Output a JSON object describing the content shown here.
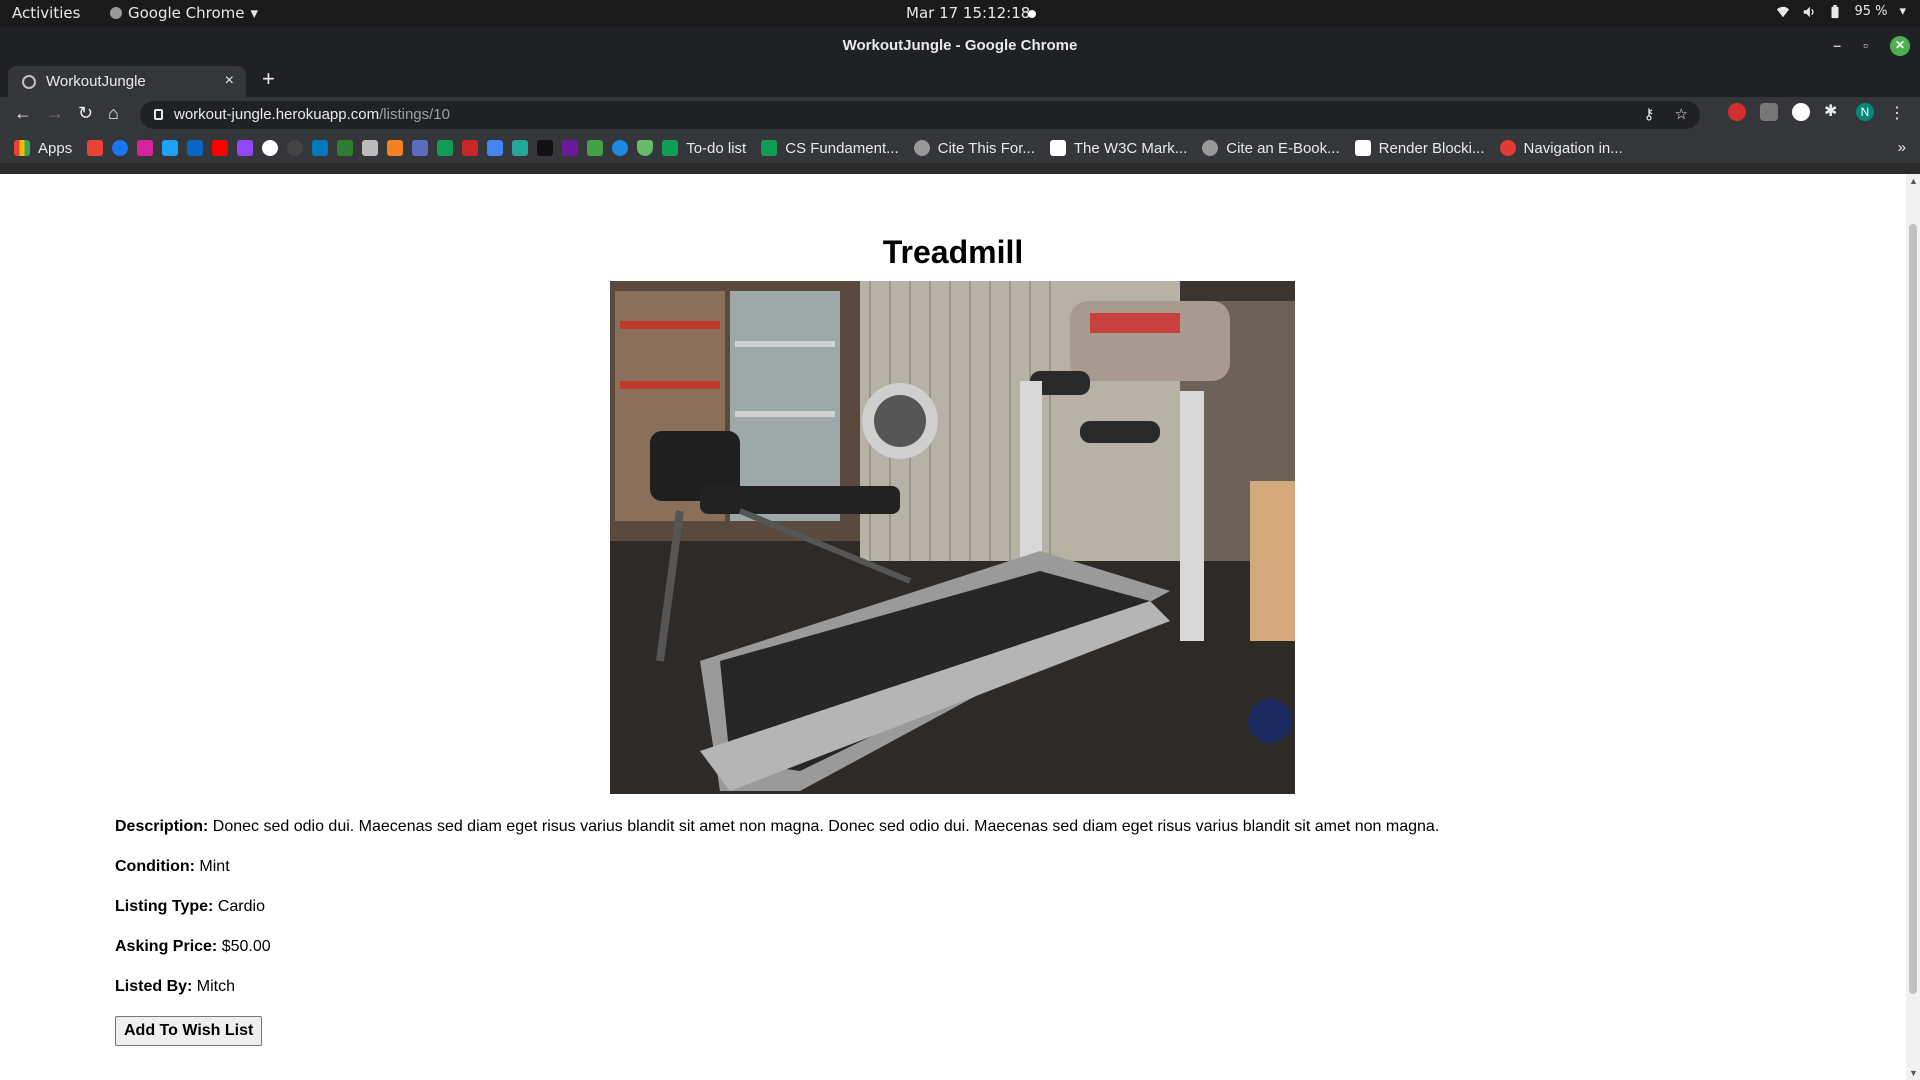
{
  "system_bar": {
    "activities": "Activities",
    "app_name": "Google Chrome",
    "clock": "Mar 17  15:12:18",
    "battery": "95 %"
  },
  "window": {
    "title": "WorkoutJungle - Google Chrome"
  },
  "tab": {
    "label": "WorkoutJungle"
  },
  "address_bar": {
    "host": "workout-jungle.herokuapp.com",
    "path": "/listings/10"
  },
  "bookmarks": {
    "apps": "Apps",
    "items": [
      "To-do list",
      "CS Fundament...",
      "Cite This For...",
      "The W3C Mark...",
      "Cite an E-Book...",
      "Render Blocki...",
      "Navigation in..."
    ],
    "user_initial": "N"
  },
  "listing": {
    "title": "Treadmill",
    "description_label": "Description:",
    "description": "Donec sed odio dui. Maecenas sed diam eget risus varius blandit sit amet non magna. Donec sed odio dui. Maecenas sed diam eget risus varius blandit sit amet non magna.",
    "condition_label": "Condition:",
    "condition": "Mint",
    "type_label": "Listing Type:",
    "type": "Cardio",
    "price_label": "Asking Price:",
    "price": "$50.00",
    "seller_label": "Listed By:",
    "seller": "Mitch",
    "wish_button": "Add To Wish List"
  },
  "colors": {
    "chrome_dark": "#202124",
    "chrome_toolbar": "#35363a",
    "page_bg": "#ffffff",
    "close_button": "#4caf50",
    "avatar": "#00897b"
  }
}
